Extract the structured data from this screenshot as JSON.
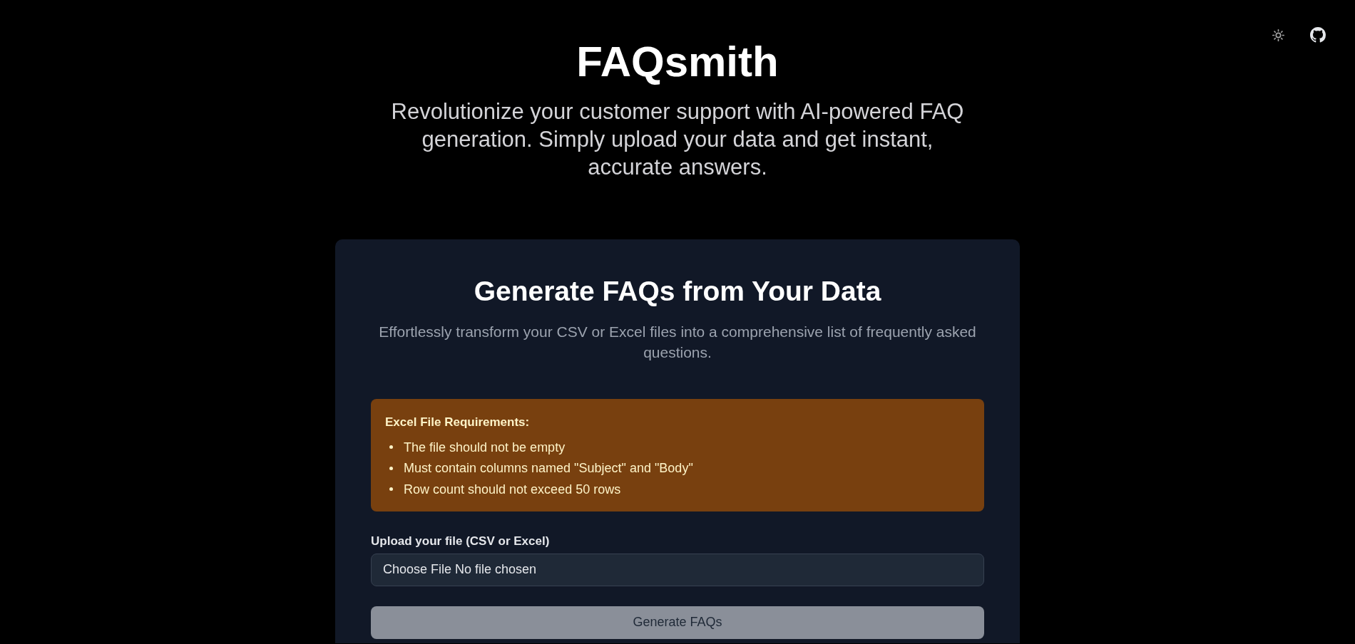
{
  "header": {
    "title": "FAQsmith",
    "subtitle": "Revolutionize your customer support with AI-powered FAQ generation. Simply upload your data and get instant, accurate answers."
  },
  "card": {
    "title": "Generate FAQs from Your Data",
    "description": "Effortlessly transform your CSV or Excel files into a comprehensive list of frequently asked questions.",
    "requirements": {
      "title": "Excel File Requirements:",
      "items": [
        "The file should not be empty",
        "Must contain columns named \"Subject\" and \"Body\"",
        "Row count should not exceed 50 rows"
      ]
    },
    "upload": {
      "label": "Upload your file (CSV or Excel)",
      "button_label": "Choose File",
      "value": "No file chosen"
    },
    "submit": {
      "label": "Generate FAQs",
      "disabled": true
    }
  }
}
